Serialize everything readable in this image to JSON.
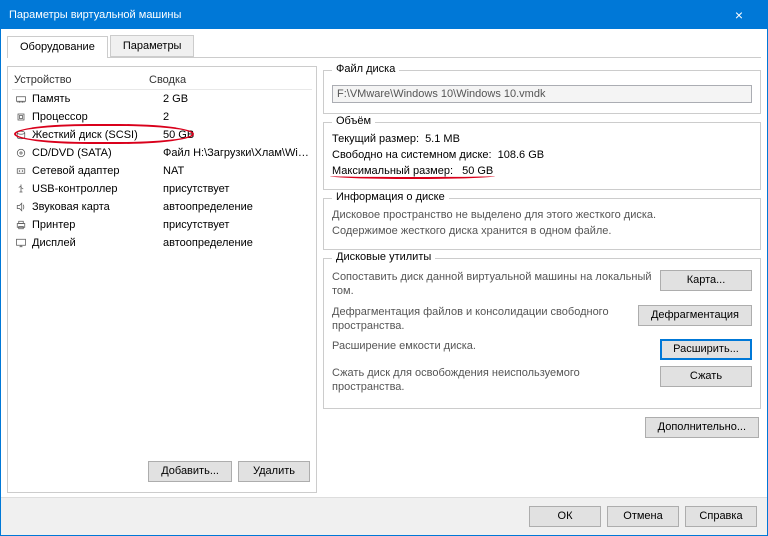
{
  "window": {
    "title": "Параметры виртуальной машины"
  },
  "tabs": {
    "hardware": "Оборудование",
    "options": "Параметры"
  },
  "deviceTable": {
    "headers": {
      "device": "Устройство",
      "summary": "Сводка"
    },
    "rows": [
      {
        "icon": "memory",
        "name": "Память",
        "summary": "2 GB"
      },
      {
        "icon": "cpu",
        "name": "Процессор",
        "summary": "2"
      },
      {
        "icon": "hdd",
        "name": "Жесткий диск (SCSI)",
        "summary": "50 GB",
        "selected": true
      },
      {
        "icon": "cd",
        "name": "CD/DVD (SATA)",
        "summary": "Файл H:\\Загрузки\\Хлам\\Win..."
      },
      {
        "icon": "net",
        "name": "Сетевой адаптер",
        "summary": "NAT"
      },
      {
        "icon": "usb",
        "name": "USB-контроллер",
        "summary": "присутствует"
      },
      {
        "icon": "sound",
        "name": "Звуковая карта",
        "summary": "автоопределение"
      },
      {
        "icon": "printer",
        "name": "Принтер",
        "summary": "присутствует"
      },
      {
        "icon": "display",
        "name": "Дисплей",
        "summary": "автоопределение"
      }
    ]
  },
  "leftButtons": {
    "add": "Добавить...",
    "remove": "Удалить"
  },
  "fileGroup": {
    "title": "Файл диска",
    "path": "F:\\VMware\\Windows 10\\Windows 10.vmdk"
  },
  "volumeGroup": {
    "title": "Объём",
    "currentLabel": "Текущий размер:",
    "currentValue": "5.1 MB",
    "freeLabel": "Свободно на системном диске:",
    "freeValue": "108.6 GB",
    "maxLabel": "Максимальный размер:",
    "maxValue": "50 GB"
  },
  "infoGroup": {
    "title": "Информация о диске",
    "line1": "Дисковое пространство не выделено для этого жесткого диска.",
    "line2": "Содержимое жесткого диска хранится в одном файле."
  },
  "utilGroup": {
    "title": "Дисковые утилиты",
    "map": {
      "desc": "Сопоставить диск данной виртуальной машины на локальный том.",
      "btn": "Карта..."
    },
    "defrag": {
      "desc": "Дефрагментация файлов и консолидации свободного пространства.",
      "btn": "Дефрагментация"
    },
    "expand": {
      "desc": "Расширение емкости диска.",
      "btn": "Расширить..."
    },
    "compact": {
      "desc": "Сжать диск для освобождения неиспользуемого пространства.",
      "btn": "Сжать"
    }
  },
  "advanced": "Дополнительно...",
  "footer": {
    "ok": "ОК",
    "cancel": "Отмена",
    "help": "Справка"
  }
}
